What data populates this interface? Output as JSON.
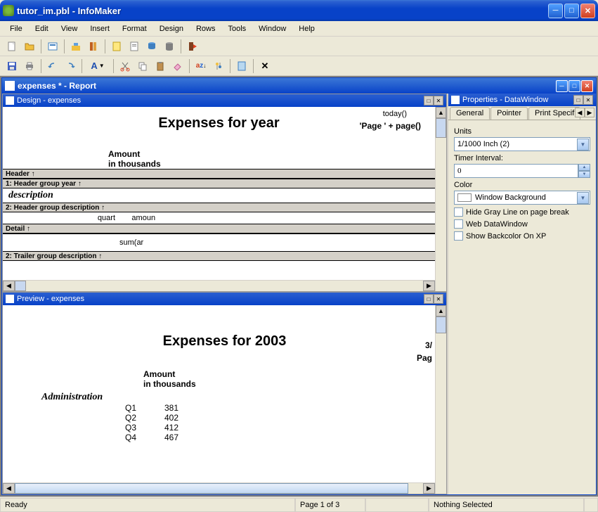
{
  "app": {
    "title": "tutor_im.pbl - InfoMaker"
  },
  "menu": [
    "File",
    "Edit",
    "View",
    "Insert",
    "Format",
    "Design",
    "Rows",
    "Tools",
    "Window",
    "Help"
  ],
  "report_window": {
    "title": "expenses * - Report"
  },
  "design_pane": {
    "title": "Design - expenses",
    "header_title": "Expenses for  year",
    "today_fn": "today()",
    "page_fn": "'Page ' + page()",
    "amount_label1": "Amount",
    "amount_label2": "in thousands",
    "band_header": "Header ↑",
    "band_group_year": "1: Header group year ↑",
    "description_label": "description",
    "band_group_desc": "2: Header group description ↑",
    "quart_label": "quart",
    "amoun_label": "amoun",
    "band_detail": "Detail ↑",
    "sum_label": "sum(ar",
    "band_trailer": "2: Trailer group description ↑"
  },
  "preview_pane": {
    "title": "Preview - expenses",
    "rpt_title": "Expenses for  2003",
    "date_partial": "3/",
    "page_partial": "Pag",
    "amount_label1": "Amount",
    "amount_label2": "in thousands",
    "group_label": "Administration",
    "rows": [
      {
        "q": "Q1",
        "v": "381"
      },
      {
        "q": "Q2",
        "v": "402"
      },
      {
        "q": "Q3",
        "v": "412"
      },
      {
        "q": "Q4",
        "v": "467"
      }
    ]
  },
  "properties": {
    "title": "Properties - DataWindow",
    "tabs": [
      "General",
      "Pointer",
      "Print Specif"
    ],
    "units_label": "Units",
    "units_value": "1/1000 Inch (2)",
    "timer_label": "Timer Interval:",
    "timer_value": "0",
    "color_label": "Color",
    "color_value": "Window Background",
    "check1": "Hide Gray Line on page break",
    "check2": "Web DataWindow",
    "check3": "Show Backcolor On XP"
  },
  "status": {
    "ready": "Ready",
    "page": "Page 1 of 3",
    "selection": "Nothing Selected"
  },
  "chart_data": {
    "type": "table",
    "title": "Expenses for 2003",
    "group": "Administration",
    "unit": "Amount in thousands",
    "categories": [
      "Q1",
      "Q2",
      "Q3",
      "Q4"
    ],
    "values": [
      381,
      402,
      412,
      467
    ]
  }
}
